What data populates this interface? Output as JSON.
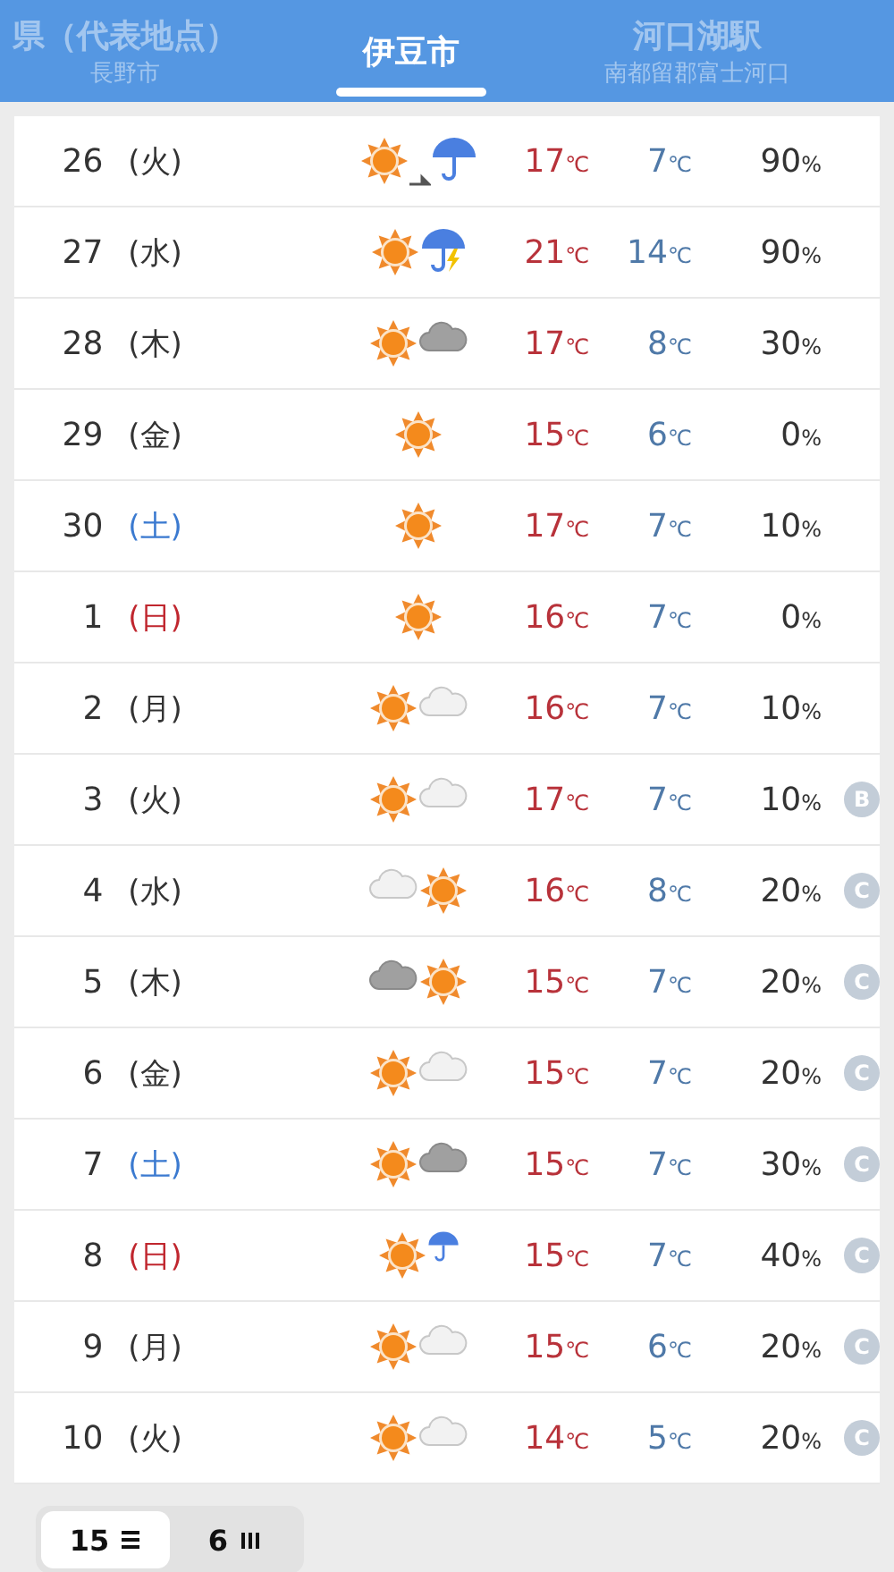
{
  "header": {
    "tabs": [
      {
        "title": "県（代表地点）",
        "subtitle": "長野市",
        "selected": false
      },
      {
        "title": "伊豆市",
        "selected": true
      },
      {
        "title": "河口湖駅",
        "subtitle": "南都留郡富士河口",
        "selected": false
      }
    ]
  },
  "rows": [
    {
      "date": "26",
      "day": "(火)",
      "kind": "weekday",
      "weather": [
        {
          "kind": "sun"
        },
        {
          "kind": "later"
        },
        {
          "kind": "rain"
        }
      ],
      "high": {
        "value": "17",
        "unit": "℃"
      },
      "low": {
        "value": "7",
        "unit": "℃"
      },
      "precip": {
        "value": "90",
        "unit": "%"
      }
    },
    {
      "date": "27",
      "day": "(水)",
      "kind": "weekday",
      "weather": [
        {
          "kind": "sun"
        },
        {
          "kind": "thunder"
        }
      ],
      "high": {
        "value": "21",
        "unit": "℃"
      },
      "low": {
        "value": "14",
        "unit": "℃"
      },
      "precip": {
        "value": "90",
        "unit": "%"
      }
    },
    {
      "date": "28",
      "day": "(木)",
      "kind": "weekday",
      "weather": [
        {
          "kind": "sun"
        },
        {
          "kind": "darkcloud"
        }
      ],
      "high": {
        "value": "17",
        "unit": "℃"
      },
      "low": {
        "value": "8",
        "unit": "℃"
      },
      "precip": {
        "value": "30",
        "unit": "%"
      }
    },
    {
      "date": "29",
      "day": "(金)",
      "kind": "weekday",
      "weather": [
        {
          "kind": "sun"
        }
      ],
      "high": {
        "value": "15",
        "unit": "℃"
      },
      "low": {
        "value": "6",
        "unit": "℃"
      },
      "precip": {
        "value": "0",
        "unit": "%"
      }
    },
    {
      "date": "30",
      "day": "(土)",
      "kind": "saturday",
      "weather": [
        {
          "kind": "sun"
        }
      ],
      "high": {
        "value": "17",
        "unit": "℃"
      },
      "low": {
        "value": "7",
        "unit": "℃"
      },
      "precip": {
        "value": "10",
        "unit": "%"
      }
    },
    {
      "date": "1",
      "day": "(日)",
      "kind": "sunday",
      "weather": [
        {
          "kind": "sun"
        }
      ],
      "high": {
        "value": "16",
        "unit": "℃"
      },
      "low": {
        "value": "7",
        "unit": "℃"
      },
      "precip": {
        "value": "0",
        "unit": "%"
      }
    },
    {
      "date": "2",
      "day": "(月)",
      "kind": "weekday",
      "weather": [
        {
          "kind": "sun"
        },
        {
          "kind": "cloud"
        }
      ],
      "high": {
        "value": "16",
        "unit": "℃"
      },
      "low": {
        "value": "7",
        "unit": "℃"
      },
      "precip": {
        "value": "10",
        "unit": "%"
      }
    },
    {
      "date": "3",
      "day": "(火)",
      "kind": "weekday",
      "weather": [
        {
          "kind": "sun"
        },
        {
          "kind": "cloud"
        }
      ],
      "high": {
        "value": "17",
        "unit": "℃"
      },
      "low": {
        "value": "7",
        "unit": "℃"
      },
      "precip": {
        "value": "10",
        "unit": "%"
      },
      "badge": "B"
    },
    {
      "date": "4",
      "day": "(水)",
      "kind": "weekday",
      "weather": [
        {
          "kind": "cloud"
        },
        {
          "kind": "sun"
        }
      ],
      "high": {
        "value": "16",
        "unit": "℃"
      },
      "low": {
        "value": "8",
        "unit": "℃"
      },
      "precip": {
        "value": "20",
        "unit": "%"
      },
      "badge": "C"
    },
    {
      "date": "5",
      "day": "(木)",
      "kind": "weekday",
      "weather": [
        {
          "kind": "darkcloud"
        },
        {
          "kind": "sun"
        }
      ],
      "high": {
        "value": "15",
        "unit": "℃"
      },
      "low": {
        "value": "7",
        "unit": "℃"
      },
      "precip": {
        "value": "20",
        "unit": "%"
      },
      "badge": "C"
    },
    {
      "date": "6",
      "day": "(金)",
      "kind": "weekday",
      "weather": [
        {
          "kind": "sun"
        },
        {
          "kind": "cloud"
        }
      ],
      "high": {
        "value": "15",
        "unit": "℃"
      },
      "low": {
        "value": "7",
        "unit": "℃"
      },
      "precip": {
        "value": "20",
        "unit": "%"
      },
      "badge": "C"
    },
    {
      "date": "7",
      "day": "(土)",
      "kind": "saturday",
      "weather": [
        {
          "kind": "sun"
        },
        {
          "kind": "darkcloud"
        }
      ],
      "high": {
        "value": "15",
        "unit": "℃"
      },
      "low": {
        "value": "7",
        "unit": "℃"
      },
      "precip": {
        "value": "30",
        "unit": "%"
      },
      "badge": "C"
    },
    {
      "date": "8",
      "day": "(日)",
      "kind": "sunday",
      "weather": [
        {
          "kind": "sun"
        },
        {
          "kind": "smallrain"
        }
      ],
      "high": {
        "value": "15",
        "unit": "℃"
      },
      "low": {
        "value": "7",
        "unit": "℃"
      },
      "precip": {
        "value": "40",
        "unit": "%"
      },
      "badge": "C"
    },
    {
      "date": "9",
      "day": "(月)",
      "kind": "weekday",
      "weather": [
        {
          "kind": "sun"
        },
        {
          "kind": "cloud"
        }
      ],
      "high": {
        "value": "15",
        "unit": "℃"
      },
      "low": {
        "value": "6",
        "unit": "℃"
      },
      "precip": {
        "value": "20",
        "unit": "%"
      },
      "badge": "C"
    },
    {
      "date": "10",
      "day": "(火)",
      "kind": "weekday",
      "weather": [
        {
          "kind": "sun"
        },
        {
          "kind": "cloud"
        }
      ],
      "high": {
        "value": "14",
        "unit": "℃"
      },
      "low": {
        "value": "5",
        "unit": "℃"
      },
      "precip": {
        "value": "20",
        "unit": "%"
      },
      "badge": "C"
    }
  ],
  "segments": [
    {
      "label": "15",
      "kind": "list",
      "selected": true
    },
    {
      "label": "6",
      "kind": "columns",
      "selected": false
    }
  ]
}
